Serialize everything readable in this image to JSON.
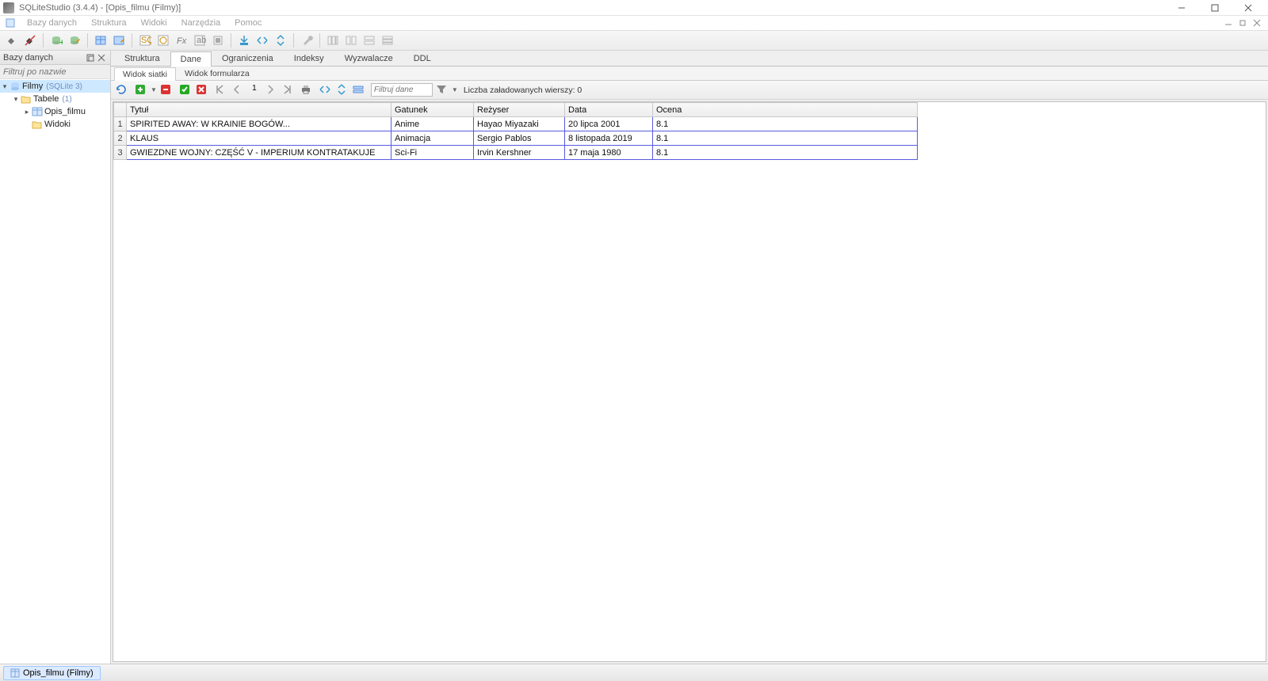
{
  "window": {
    "title": "SQLiteStudio (3.4.4) - [Opis_filmu (Filmy)]"
  },
  "menubar": [
    "Bazy danych",
    "Struktura",
    "Widoki",
    "Narzędzia",
    "Pomoc"
  ],
  "sidebar": {
    "title": "Bazy danych",
    "filter_placeholder": "Filtruj po nazwie",
    "tree": {
      "db": {
        "label": "Filmy",
        "note": "(SQLite 3)"
      },
      "tables_group": {
        "label": "Tabele",
        "note": "(1)"
      },
      "table": "Opis_filmu",
      "views_group": "Widoki"
    }
  },
  "tabs": [
    "Struktura",
    "Dane",
    "Ograniczenia",
    "Indeksy",
    "Wyzwalacze",
    "DDL"
  ],
  "active_tab": 1,
  "subtabs": [
    "Widok siatki",
    "Widok formularza"
  ],
  "active_subtab": 0,
  "gridbar": {
    "page": "1",
    "filter_placeholder": "Filtruj dane",
    "rowcount_label": "Liczba załadowanych wierszy: 0"
  },
  "columns": [
    "Tytuł",
    "Gatunek",
    "Reżyser",
    "Data",
    "Ocena"
  ],
  "rows": [
    [
      "SPIRITED AWAY: W KRAINIE BOGÓW...",
      "Anime",
      "Hayao Miyazaki",
      "20 lipca 2001",
      "8.1"
    ],
    [
      "KLAUS",
      "Animacja",
      "Sergio Pablos",
      "8 listopada 2019",
      "8.1"
    ],
    [
      "GWIEZDNE WOJNY: CZĘŚĆ V - IMPERIUM KONTRATAKUJE",
      "Sci-Fi",
      "Irvin Kershner",
      "17 maja 1980",
      "8.1"
    ]
  ],
  "docbar": {
    "label": "Opis_filmu (Filmy)"
  }
}
